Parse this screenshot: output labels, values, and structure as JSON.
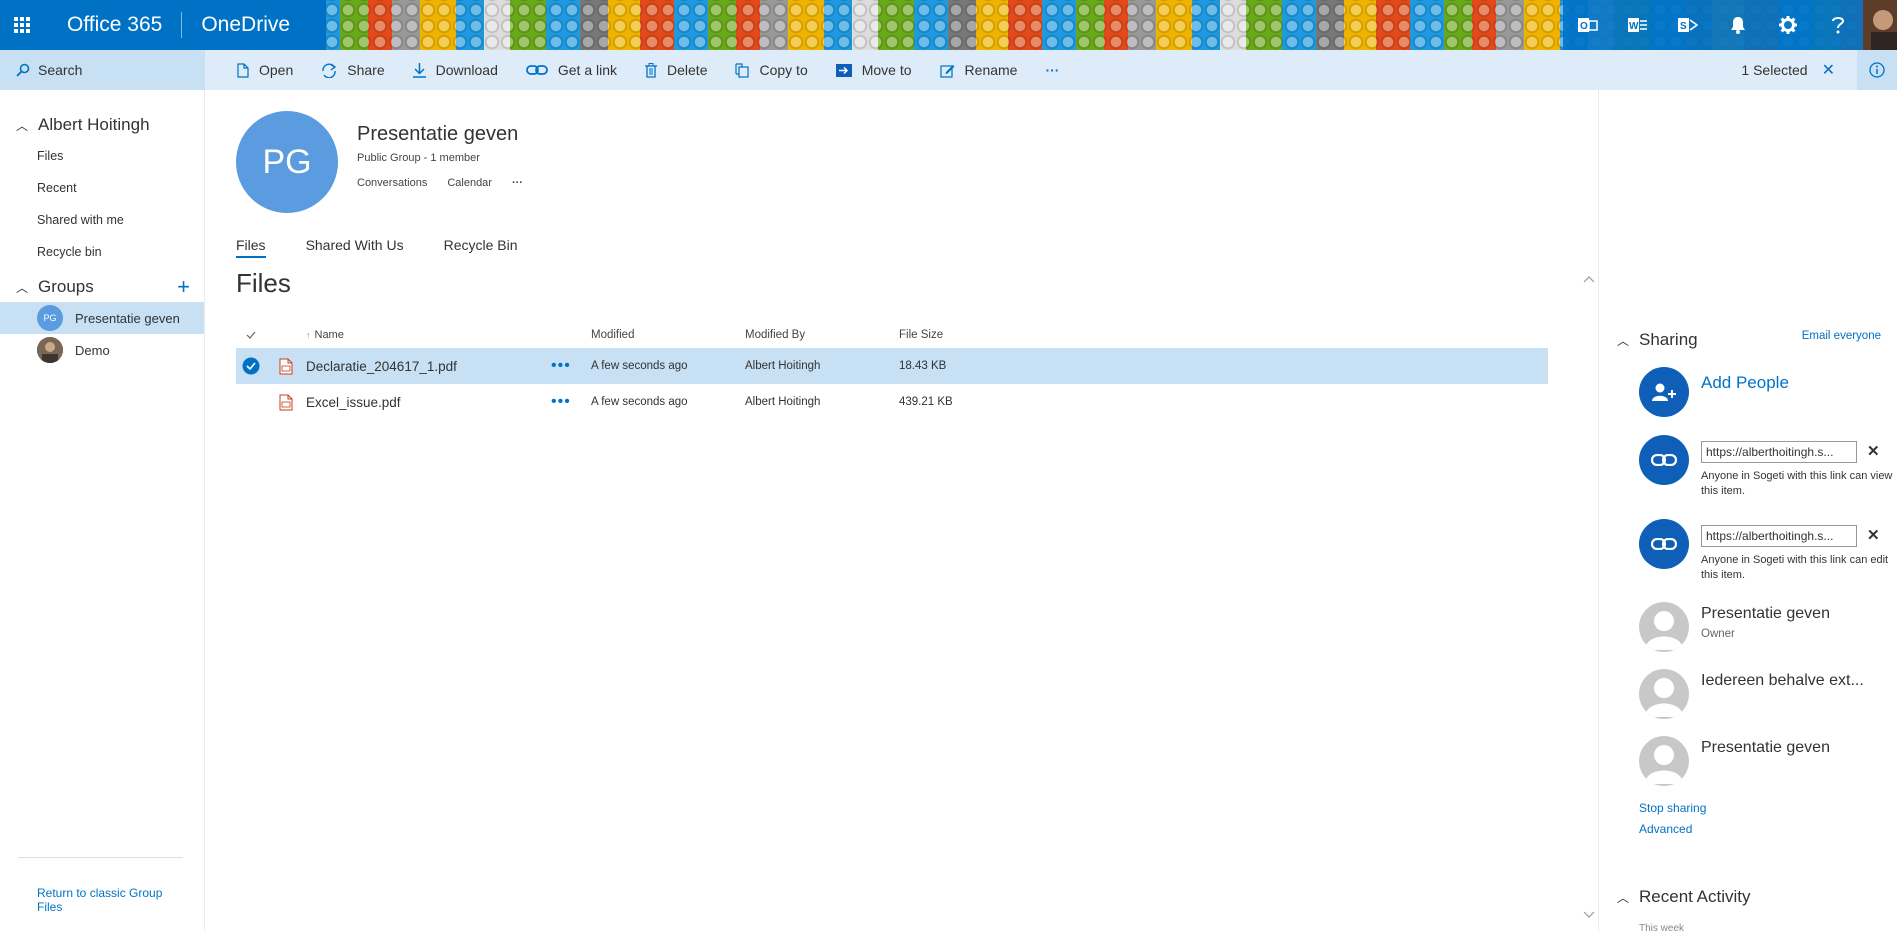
{
  "suitebar": {
    "app_name": "Office 365",
    "product_name": "OneDrive",
    "icons": [
      "waffle-icon",
      "outlook-icon",
      "word-icon",
      "sway-icon",
      "bell-icon",
      "gear-icon",
      "help-icon",
      "avatar"
    ]
  },
  "commandbar": {
    "search_label": "Search",
    "commands": [
      {
        "label": "Open",
        "icon": "open-icon"
      },
      {
        "label": "Share",
        "icon": "share-icon"
      },
      {
        "label": "Download",
        "icon": "download-icon"
      },
      {
        "label": "Get a link",
        "icon": "link-icon"
      },
      {
        "label": "Delete",
        "icon": "delete-icon"
      },
      {
        "label": "Copy to",
        "icon": "copy-icon"
      },
      {
        "label": "Move to",
        "icon": "move-icon"
      },
      {
        "label": "Rename",
        "icon": "rename-icon"
      },
      {
        "label": "···",
        "icon": "more-icon"
      }
    ],
    "selection": "1 Selected"
  },
  "leftnav": {
    "user": "Albert Hoitingh",
    "items": [
      "Files",
      "Recent",
      "Shared with me",
      "Recycle bin"
    ],
    "groups_label": "Groups",
    "groups": [
      {
        "initials": "PG",
        "label": "Presentatie geven",
        "active": true
      },
      {
        "initials": "",
        "label": "Demo",
        "active": false
      }
    ],
    "return_link": "Return to classic Group Files"
  },
  "group": {
    "initials": "PG",
    "title": "Presentatie geven",
    "subtitle": "Public Group - 1 member",
    "links": [
      "Conversations",
      "Calendar",
      "···"
    ]
  },
  "tabs": [
    {
      "label": "Files",
      "active": true
    },
    {
      "label": "Shared With Us",
      "active": false
    },
    {
      "label": "Recycle Bin",
      "active": false
    }
  ],
  "files_heading": "Files",
  "table": {
    "columns": {
      "name": "Name",
      "modified": "Modified",
      "modified_by": "Modified By",
      "size": "File Size"
    },
    "rows": [
      {
        "name": "Declaratie_204617_1.pdf",
        "modified": "A few seconds ago",
        "modified_by": "Albert Hoitingh",
        "size": "18.43 KB",
        "selected": true
      },
      {
        "name": "Excel_issue.pdf",
        "modified": "A few seconds ago",
        "modified_by": "Albert Hoitingh",
        "size": "439.21 KB",
        "selected": false
      }
    ]
  },
  "sharing": {
    "heading": "Sharing",
    "email_everyone": "Email everyone",
    "add_people": "Add People",
    "links": [
      {
        "url": "https://alberthoitingh.s...",
        "desc": "Anyone in Sogeti with this link can view this item."
      },
      {
        "url": "https://alberthoitingh.s...",
        "desc": "Anyone in Sogeti with this link can edit this item."
      }
    ],
    "people": [
      {
        "name": "Presentatie geven",
        "role": "Owner"
      },
      {
        "name": "Iedereen behalve ext...",
        "role": ""
      },
      {
        "name": "Presentatie geven",
        "role": ""
      }
    ],
    "stop_sharing": "Stop sharing",
    "advanced": "Advanced"
  },
  "recent_activity": {
    "heading": "Recent Activity",
    "period": "This week"
  },
  "colors": {
    "accent": "#0072c6",
    "selection": "#c7e0f4",
    "commandbar": "#deecf9",
    "sharecircle": "#0f5fb9"
  }
}
